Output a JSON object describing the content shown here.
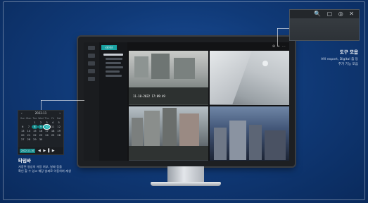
{
  "monitor": {
    "live_tab": "라이브",
    "camera_timestamp": "11-10-2022 17:09:49",
    "camera_toolbar_icons": "⊕ ⌖ ⋯"
  },
  "timebar_popup": {
    "month_label": "2022-11",
    "weekdays": [
      "Sun",
      "Mon",
      "Tue",
      "Wed",
      "Thu",
      "Fri",
      "Sat"
    ],
    "days": [
      "",
      "",
      "1",
      "2",
      "3",
      "4",
      "5",
      "6",
      "7",
      "8",
      "9",
      "10",
      "11",
      "12",
      "13",
      "14",
      "15",
      "16",
      "17",
      "18",
      "19",
      "20",
      "21",
      "22",
      "23",
      "24",
      "25",
      "26",
      "27",
      "28",
      "29",
      "30",
      "",
      "",
      ""
    ],
    "recorded_days": [
      "8",
      "9"
    ],
    "selected_day": "10",
    "date_field": "2022-11-10",
    "controls": "◀ ▶▐ ▶"
  },
  "timebar_caption": {
    "title": "타임바",
    "line1": "저장된 영상의 저장 여부, 날짜 등을",
    "line2": "확인 할 수 있고 해당 날짜로 이동하여 재생"
  },
  "tool_popup": {
    "icons": "🔍 ▢ ◎ ✕"
  },
  "tool_caption": {
    "title": "도구 모음",
    "line1": "AVI export, Digital 줌 등",
    "line2": "추가 기능 모음"
  },
  "colors": {
    "accent": "#1aa3a3",
    "background": "#103a78"
  }
}
